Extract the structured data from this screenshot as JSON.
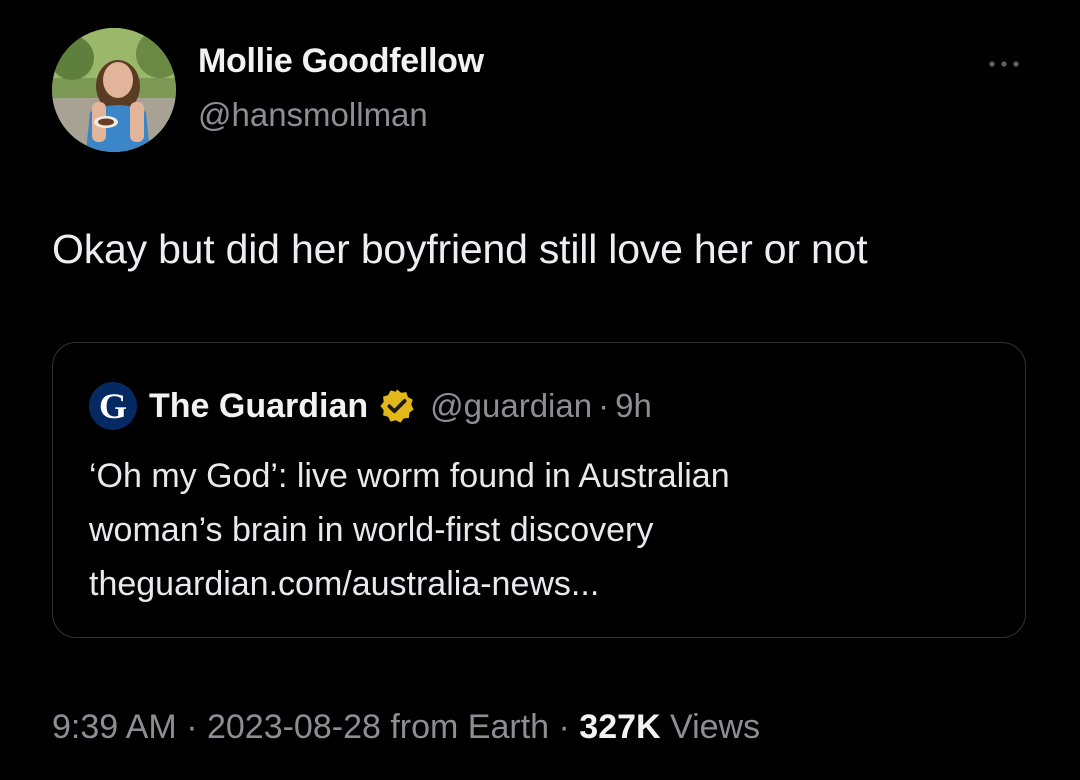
{
  "author": {
    "name": "Mollie Goodfellow",
    "handle": "@hansmollman"
  },
  "tweet": {
    "text": "Okay but did her boyfriend still love her or not"
  },
  "quote": {
    "logo_letter": "G",
    "name": "The Guardian",
    "handle": "@guardian",
    "separator": "·",
    "time": "9h",
    "headline_line1": "‘Oh my God’: live worm found in Australian",
    "headline_line2": "woman’s brain in world-first discovery",
    "link": "theguardian.com/australia-news..."
  },
  "meta": {
    "time": "9:39 AM",
    "sep1": " · ",
    "date": "2023-08-28",
    "source": " from Earth",
    "sep2": " · ",
    "views_count": "327K",
    "views_label": " Views"
  },
  "icons": {
    "more": "more-horizontal-icon",
    "verified": "verified-badge-icon",
    "logo": "guardian-logo-icon"
  },
  "colors": {
    "background": "#000000",
    "text": "#e7e9ea",
    "secondary_text": "#8b8f94",
    "border": "#2f3336",
    "verified_gold": "#e2b719",
    "guardian_blue": "#052962"
  }
}
